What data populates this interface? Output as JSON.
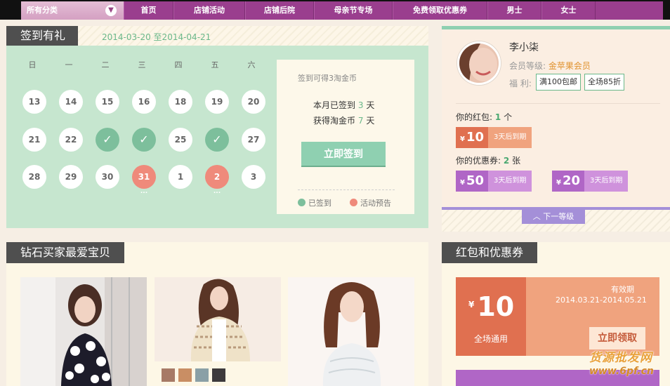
{
  "nav": {
    "category_label": "所有分类",
    "items": [
      "首页",
      "店铺活动",
      "店铺后院",
      "母亲节专场",
      "免费领取优惠券",
      "男士",
      "女士"
    ]
  },
  "checkin": {
    "title": "签到有礼",
    "date_range": "2014-03-20 至2014-04-21",
    "weekdays": [
      "日",
      "一",
      "二",
      "三",
      "四",
      "五",
      "六"
    ],
    "weeks": [
      [
        {
          "d": "13",
          "s": "normal"
        },
        {
          "d": "14",
          "s": "normal"
        },
        {
          "d": "15",
          "s": "normal"
        },
        {
          "d": "16",
          "s": "normal"
        },
        {
          "d": "18",
          "s": "normal"
        },
        {
          "d": "19",
          "s": "normal"
        },
        {
          "d": "20",
          "s": "normal"
        }
      ],
      [
        {
          "d": "21",
          "s": "normal"
        },
        {
          "d": "22",
          "s": "normal"
        },
        {
          "d": "✓",
          "s": "done"
        },
        {
          "d": "✓",
          "s": "done"
        },
        {
          "d": "25",
          "s": "normal"
        },
        {
          "d": "✓",
          "s": "done"
        },
        {
          "d": "27",
          "s": "normal"
        }
      ],
      [
        {
          "d": "28",
          "s": "normal"
        },
        {
          "d": "29",
          "s": "normal"
        },
        {
          "d": "30",
          "s": "normal"
        },
        {
          "d": "31",
          "s": "preview"
        },
        {
          "d": "1",
          "s": "normal"
        },
        {
          "d": "2",
          "s": "preview"
        },
        {
          "d": "3",
          "s": "normal"
        }
      ]
    ],
    "info_title": "签到可得3淘金币",
    "month_signed_prefix": "本月已签到",
    "month_signed_value": "3",
    "month_signed_unit": "天",
    "coins_prefix": "获得淘金币",
    "coins_value": "7",
    "coins_unit": "天",
    "sign_button": "立即签到",
    "legend_signed": "已签到",
    "legend_preview": "活动预告",
    "colors": {
      "signed": "#7dbf9c",
      "preview": "#ef8a7b"
    }
  },
  "diamond": {
    "title": "钻石买家最爱宝贝"
  },
  "profile": {
    "name": "李小柒",
    "level_label": "会员等级:",
    "level_value": "金苹果会员",
    "perks_label": "福  利:",
    "perks": [
      "满100包邮",
      "全场85折"
    ],
    "redpack_label": "你的红包:",
    "redpack_count": "1",
    "redpack_unit": "个",
    "redpacks": [
      {
        "currency": "¥",
        "amount": "10",
        "expiry": "3天后到期"
      }
    ],
    "voucher_label": "你的优惠券:",
    "voucher_count": "2",
    "voucher_unit": "张",
    "vouchers": [
      {
        "currency": "¥",
        "amount": "50",
        "expiry": "3天后到期"
      },
      {
        "currency": "¥",
        "amount": "20",
        "expiry": "3天后到期"
      }
    ],
    "next_level": "下一等级"
  },
  "rcoupons": {
    "title": "红包和优惠券",
    "coupon": {
      "currency": "¥",
      "amount": "10",
      "scope": "全场通用",
      "valid_label": "有效期",
      "valid_range": "2014.03.21-2014.05.21",
      "claim_button": "立即领取"
    },
    "watermark_cn": "货源批发网",
    "watermark_url": "www.6pf.cn"
  }
}
